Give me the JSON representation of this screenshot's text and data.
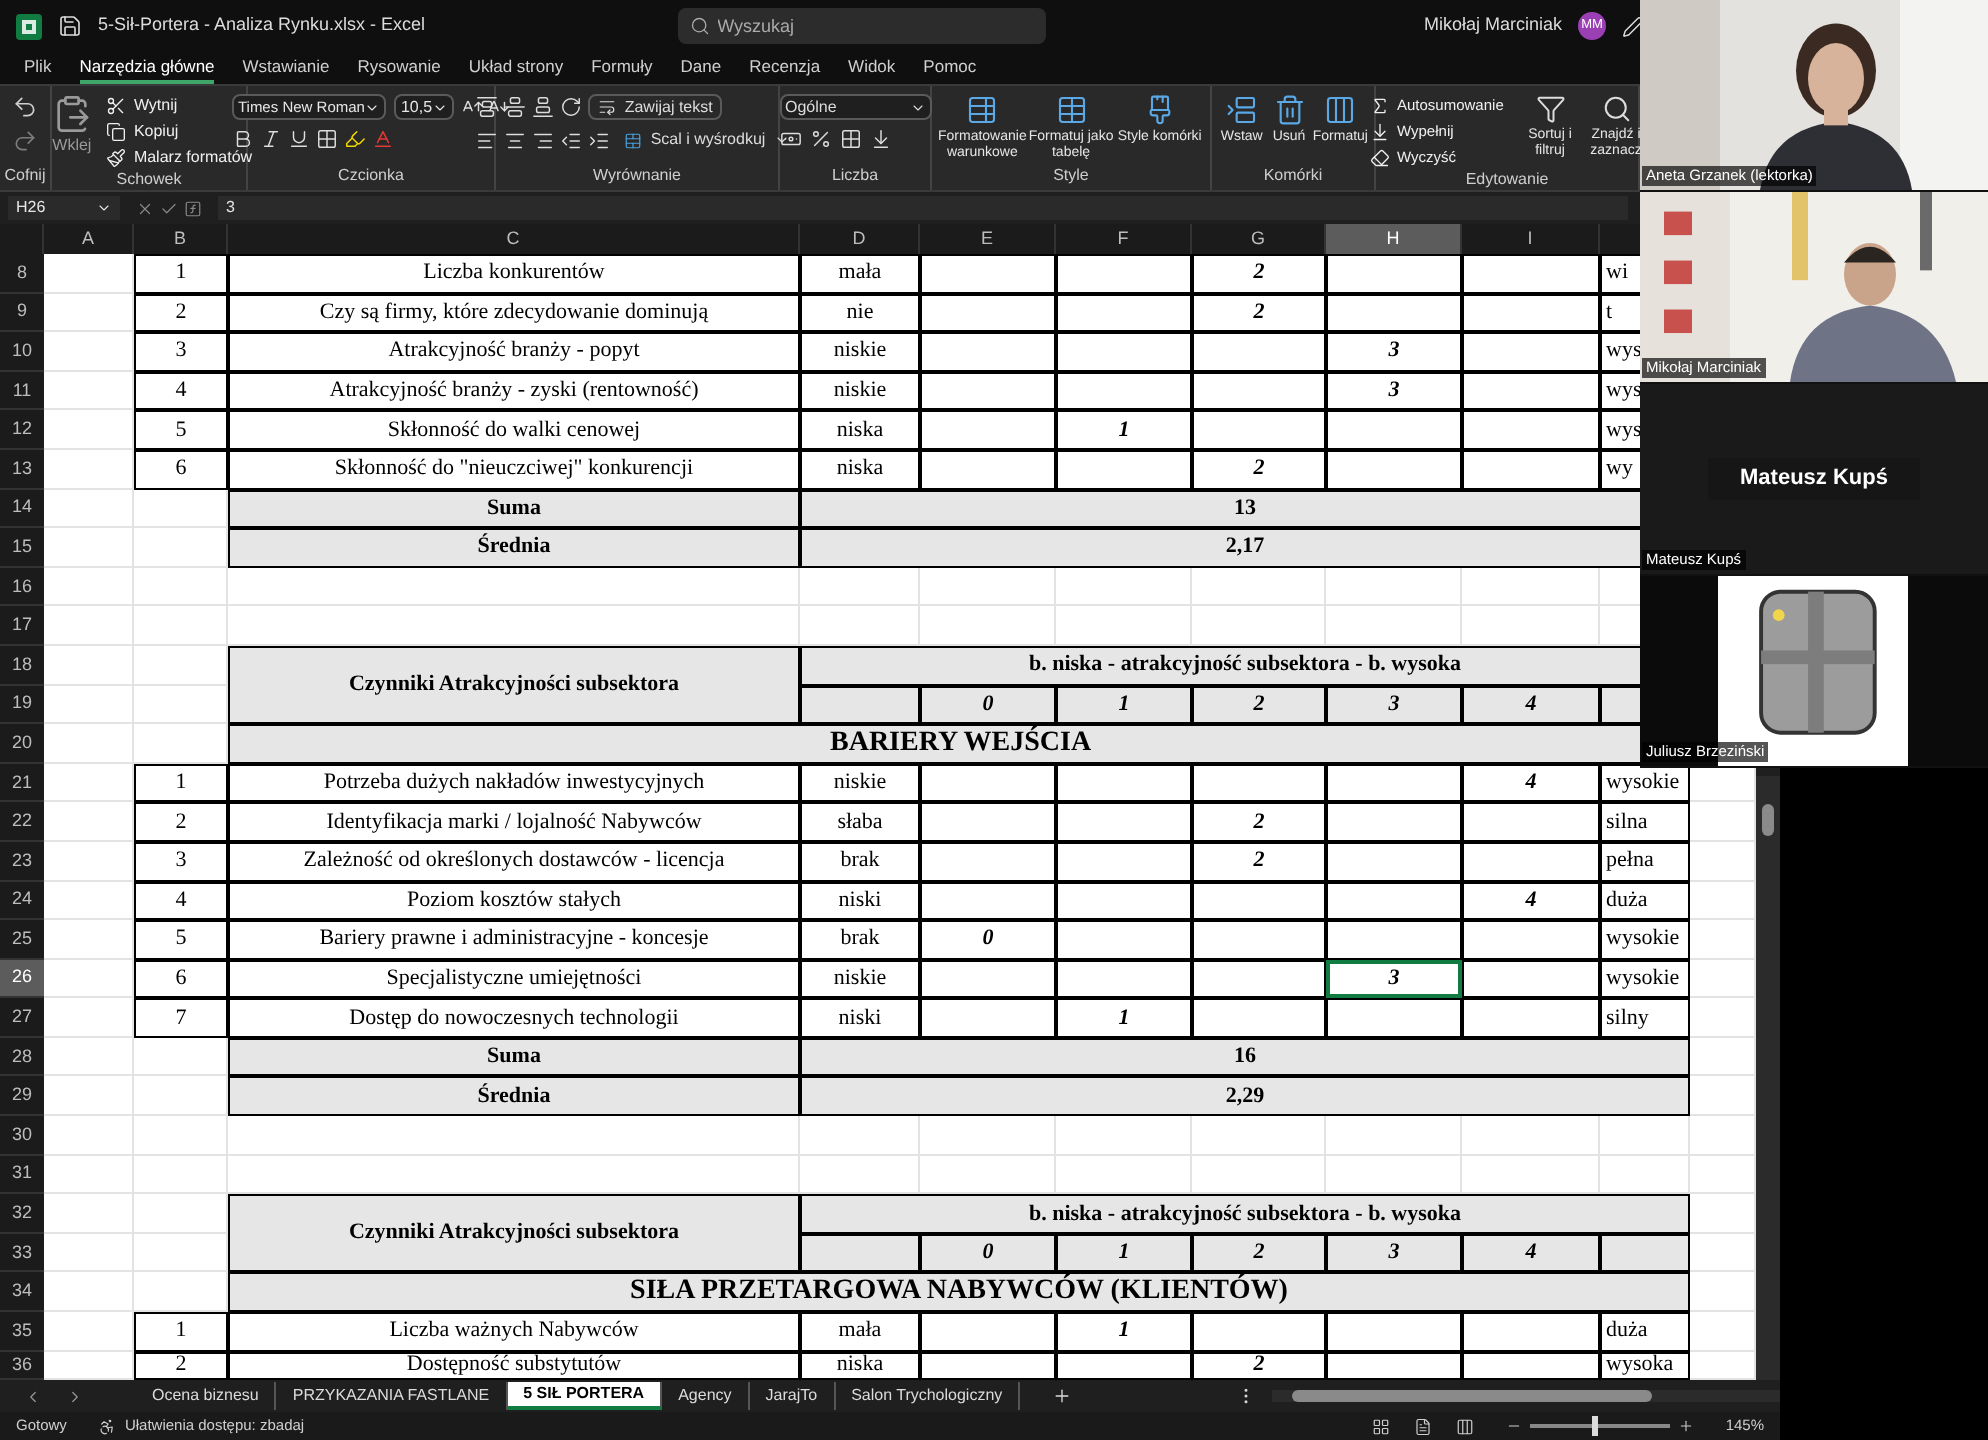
{
  "window": {
    "title": "5-Sił-Portera - Analiza Rynku.xlsx - Excel",
    "search": {
      "placeholder": "Wyszukaj"
    },
    "user": "Mikołaj Marciniak",
    "avatar": "MM"
  },
  "menu_tabs": [
    {
      "label": "Plik",
      "selected": false
    },
    {
      "label": "Narzędzia główne",
      "selected": true
    },
    {
      "label": "Wstawianie",
      "selected": false
    },
    {
      "label": "Rysowanie",
      "selected": false
    },
    {
      "label": "Układ strony",
      "selected": false
    },
    {
      "label": "Formuły",
      "selected": false
    },
    {
      "label": "Dane",
      "selected": false
    },
    {
      "label": "Recenzja",
      "selected": false
    },
    {
      "label": "Widok",
      "selected": false
    },
    {
      "label": "Pomoc",
      "selected": false
    }
  ],
  "ribbon": {
    "groups": [
      {
        "kind": "undo",
        "label": "Cofnij"
      },
      {
        "kind": "clipboard",
        "label": "Schowek",
        "paste": "Wklej",
        "items": [
          "Wytnij",
          "Kopiuj",
          "Malarz formatów"
        ]
      },
      {
        "kind": "font",
        "label": "Czcionka",
        "font": "Times New Roman",
        "size": "10,5"
      },
      {
        "kind": "alignment",
        "label": "Wyrównanie",
        "wrap": "Zawijaj tekst",
        "merge": "Scal i wyśrodkuj"
      },
      {
        "kind": "number",
        "label": "Liczba",
        "format": "Ogólne"
      },
      {
        "kind": "big",
        "label": "Style",
        "items": [
          "Formatowanie warunkowe",
          "Formatuj jako tabelę",
          "Style komórki"
        ]
      },
      {
        "kind": "big",
        "label": "Komórki",
        "items": [
          "Wstaw",
          "Usuń",
          "Formatuj"
        ]
      },
      {
        "kind": "editing",
        "label": "Edytowanie",
        "items": [
          "Autosumowanie",
          "Wypełnij",
          "Wyczyść"
        ],
        "big": [
          "Sortuj i filtruj",
          "Znajdź i zaznacz"
        ]
      }
    ]
  },
  "formula_bar": {
    "name_box": "H26",
    "value": "3"
  },
  "sheet": {
    "columns": [
      {
        "label": "A",
        "selected": false
      },
      {
        "label": "B",
        "selected": false
      },
      {
        "label": "C",
        "selected": false
      },
      {
        "label": "D",
        "selected": false
      },
      {
        "label": "E",
        "selected": false
      },
      {
        "label": "F",
        "selected": false
      },
      {
        "label": "G",
        "selected": false
      },
      {
        "label": "H",
        "selected": true
      },
      {
        "label": "I",
        "selected": false
      }
    ],
    "rows": [
      {
        "number": "8",
        "kind": "item",
        "no": "1",
        "factor": "Liczba konkurentów",
        "low": "mała",
        "score_2": "2",
        "high": "wi",
        "selected": false
      },
      {
        "number": "9",
        "kind": "item",
        "no": "2",
        "factor": "Czy są firmy, które zdecydowanie dominują",
        "low": "nie",
        "score_2": "2",
        "high": "t",
        "selected": false
      },
      {
        "number": "10",
        "kind": "item",
        "no": "3",
        "factor": "Atrakcyjność branży - popyt",
        "low": "niskie",
        "score_3": "3",
        "high": "wys",
        "selected": false
      },
      {
        "number": "11",
        "kind": "item",
        "no": "4",
        "factor": "Atrakcyjność branży - zyski (rentowność)",
        "low": "niskie",
        "score_3": "3",
        "high": "wys",
        "selected": false
      },
      {
        "number": "12",
        "kind": "item",
        "no": "5",
        "factor": "Skłonność do walki cenowej",
        "low": "niska",
        "score_1": "1",
        "high": "wys",
        "selected": false
      },
      {
        "number": "13",
        "kind": "item",
        "no": "6",
        "factor": "Skłonność do \"nieuczciwej\" konkurencji",
        "low": "niska",
        "score_2": "2",
        "high": "wy",
        "selected": false
      },
      {
        "number": "14",
        "kind": "sum",
        "label": "Suma",
        "value": "13"
      },
      {
        "number": "15",
        "kind": "sum",
        "label": "Średnia",
        "value": "2,17"
      },
      {
        "number": "16",
        "kind": "blank"
      },
      {
        "number": "17",
        "kind": "blank"
      },
      {
        "number": "18",
        "kind": "header",
        "label": "Czynniki Atrakcyjności subsektora",
        "scale": "b. niska - atrakcyjność subsektora - b. wysoka"
      },
      {
        "number": "19",
        "kind": "ticks",
        "ticks": [
          "0",
          "1",
          "2",
          "3",
          "4"
        ]
      },
      {
        "number": "20",
        "kind": "section",
        "title": "BARIERY WEJŚCIA"
      },
      {
        "number": "21",
        "kind": "item",
        "no": "1",
        "factor": "Potrzeba dużych nakładów inwestycyjnych",
        "low": "niskie",
        "score_4": "4",
        "high": "wysokie",
        "selected": false
      },
      {
        "number": "22",
        "kind": "item",
        "no": "2",
        "factor": "Identyfikacja marki / lojalność Nabywców",
        "low": "słaba",
        "score_2": "2",
        "high": "silna",
        "selected": false
      },
      {
        "number": "23",
        "kind": "item",
        "no": "3",
        "factor": "Zależność od określonych dostawców - licencja",
        "low": "brak",
        "score_2": "2",
        "high": "pełna",
        "selected": false
      },
      {
        "number": "24",
        "kind": "item",
        "no": "4",
        "factor": "Poziom kosztów stałych",
        "low": "niski",
        "score_4": "4",
        "high": "duża",
        "selected": false
      },
      {
        "number": "25",
        "kind": "item",
        "no": "5",
        "factor": "Bariery prawne i administracyjne - koncesje",
        "low": "brak",
        "score_0": "0",
        "high": "wysokie",
        "selected": false
      },
      {
        "number": "26",
        "kind": "item",
        "no": "6",
        "factor": "Specjalistyczne umiejętności",
        "low": "niskie",
        "score_3": "3",
        "high": "wysokie",
        "selected": true
      },
      {
        "number": "27",
        "kind": "item",
        "no": "7",
        "factor": "Dostęp do nowoczesnych technologii",
        "low": "niski",
        "score_1": "1",
        "high": "silny",
        "selected": false
      },
      {
        "number": "28",
        "kind": "sum",
        "label": "Suma",
        "value": "16"
      },
      {
        "number": "29",
        "kind": "sum",
        "label": "Średnia",
        "value": "2,29"
      },
      {
        "number": "30",
        "kind": "blank"
      },
      {
        "number": "31",
        "kind": "blank"
      },
      {
        "number": "32",
        "kind": "header",
        "label": "Czynniki Atrakcyjności subsektora",
        "scale": "b. niska - atrakcyjność subsektora - b. wysoka"
      },
      {
        "number": "33",
        "kind": "ticks",
        "ticks": [
          "0",
          "1",
          "2",
          "3",
          "4"
        ]
      },
      {
        "number": "34",
        "kind": "banner",
        "title": "SIŁA PRZETARGOWA NABYWCÓW (KLIENTÓW)"
      },
      {
        "number": "35",
        "kind": "item",
        "no": "1",
        "factor": "Liczba ważnych Nabywców",
        "low": "mała",
        "score_1": "1",
        "high": "duża",
        "selected": false
      },
      {
        "number": "36",
        "kind": "item",
        "no": "2",
        "factor": "Dostępność substytutów",
        "low": "niska",
        "score_2": "2",
        "high": "wysoka",
        "selected": false
      }
    ]
  },
  "sheet_tabs": [
    {
      "label": "Ocena biznesu",
      "selected": false
    },
    {
      "label": "PRZYKAZANIA FASTLANE",
      "selected": false
    },
    {
      "label": "5 SIŁ PORTERA",
      "selected": true
    },
    {
      "label": "Agency",
      "selected": false
    },
    {
      "label": "JarajTo",
      "selected": false
    },
    {
      "label": "Salon Trychologiczny",
      "selected": false
    }
  ],
  "status_bar": {
    "status": "Gotowy",
    "accessibility": "Ułatwienia dostępu: zbadaj",
    "zoom": {
      "level": 0.45,
      "reading": "145%"
    }
  },
  "participants": [
    {
      "name": "Aneta Grzanek (lektorka)",
      "kind": "video"
    },
    {
      "name": "Mikołaj Marciniak",
      "kind": "video"
    },
    {
      "name": "Mateusz Kupś",
      "kind": "camera_off",
      "display_name": "Mateusz Kupś"
    },
    {
      "name": "Juliusz Brzeziński",
      "kind": "avatar"
    }
  ]
}
